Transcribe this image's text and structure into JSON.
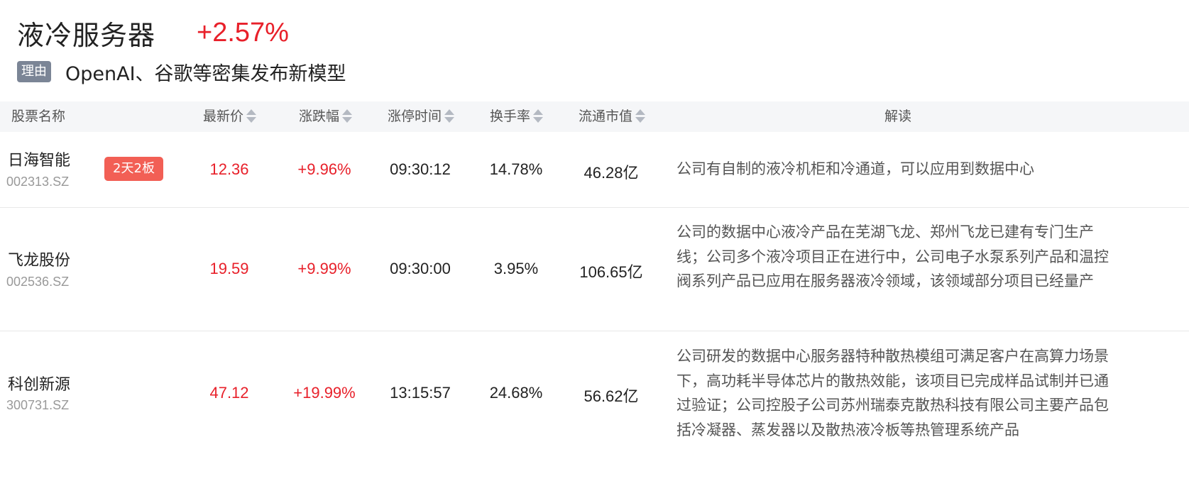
{
  "sector": {
    "title": "液冷服务器",
    "change": "+2.57%",
    "reason_tag": "理由",
    "reason": "OpenAI、谷歌等密集发布新模型"
  },
  "table": {
    "columns": [
      "股票名称",
      "最新价",
      "涨跌幅",
      "涨停时间",
      "换手率",
      "流通市值",
      "解读"
    ],
    "rows": [
      {
        "name": "日海智能",
        "code": "002313.SZ",
        "badge": "2天2板",
        "price": "12.36",
        "change": "+9.96%",
        "limit_time": "09:30:12",
        "turnover": "14.78%",
        "market_cap": "46.28亿",
        "desc": "公司有自制的液冷机柜和冷通道，可以应用到数据中心"
      },
      {
        "name": "飞龙股份",
        "code": "002536.SZ",
        "price": "19.59",
        "change": "+9.99%",
        "limit_time": "09:30:00",
        "turnover": "3.95%",
        "market_cap": "106.65亿",
        "desc": "公司的数据中心液冷产品在芜湖飞龙、郑州飞龙已建有专门生产线；公司多个液冷项目正在进行中，公司电子水泵系列产品和温控阀系列产品已应用在服务器液冷领域，该领域部分项目已经量产"
      },
      {
        "name": "科创新源",
        "code": "300731.SZ",
        "price": "47.12",
        "change": "+19.99%",
        "limit_time": "13:15:57",
        "turnover": "24.68%",
        "market_cap": "56.62亿",
        "desc": "公司研发的数据中心服务器特种散热模组可满足客户在高算力场景下，高功耗半导体芯片的散热效能，该项目已完成样品试制并已通过验证；公司控股子公司苏州瑞泰克散热科技有限公司主要产品包括冷凝器、蒸发器以及散热液冷板等热管理系统产品"
      }
    ]
  },
  "colors": {
    "up": "#e8202a",
    "badge": "#f25f55",
    "reason_tag": "#7b8596",
    "header_bg": "#f5f6f8"
  }
}
